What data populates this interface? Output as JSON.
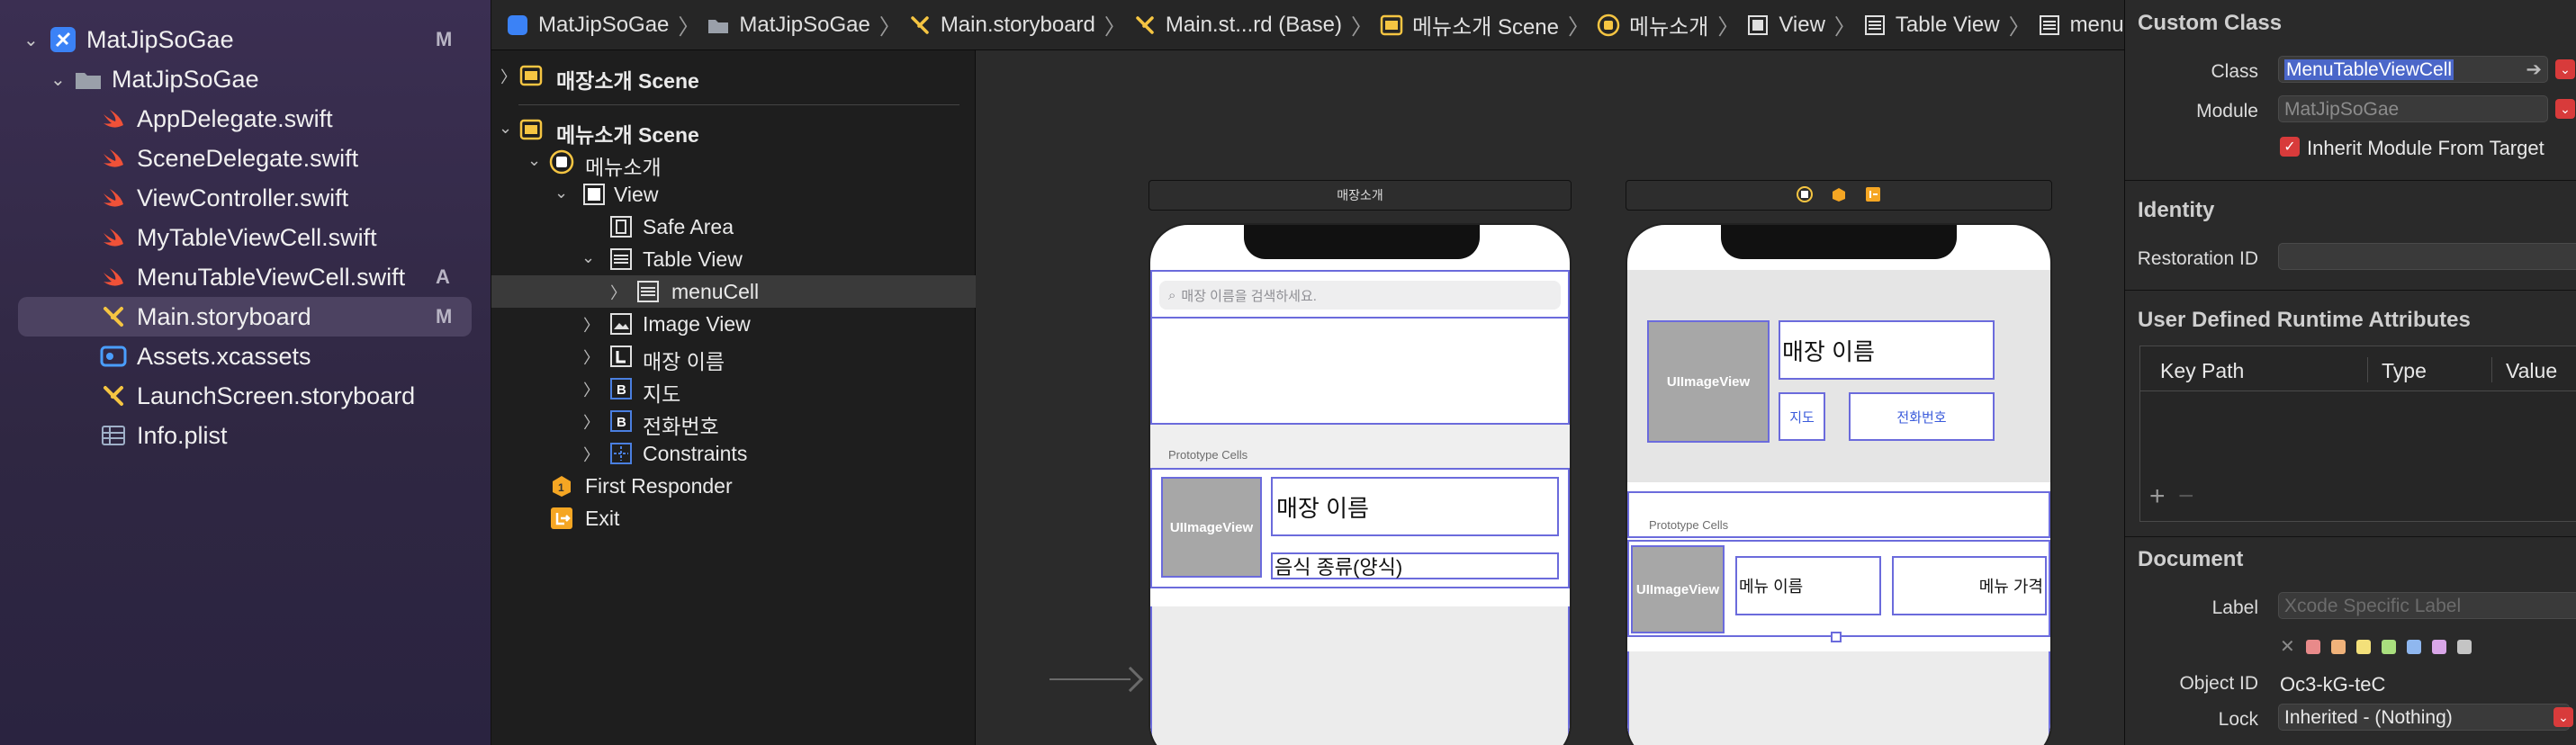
{
  "navigator": {
    "items": [
      {
        "label": "MatJipSoGae",
        "badge": "M"
      },
      {
        "label": "MatJipSoGae",
        "badge": ""
      },
      {
        "label": "AppDelegate.swift",
        "badge": ""
      },
      {
        "label": "SceneDelegate.swift",
        "badge": ""
      },
      {
        "label": "ViewController.swift",
        "badge": ""
      },
      {
        "label": "MyTableViewCell.swift",
        "badge": ""
      },
      {
        "label": "MenuTableViewCell.swift",
        "badge": "A"
      },
      {
        "label": "Main.storyboard",
        "badge": "M"
      },
      {
        "label": "Assets.xcassets",
        "badge": ""
      },
      {
        "label": "LaunchScreen.storyboard",
        "badge": ""
      },
      {
        "label": "Info.plist",
        "badge": ""
      }
    ]
  },
  "jumpbar": {
    "items": [
      "MatJipSoGae",
      "MatJipSoGae",
      "Main.storyboard",
      "Main.st...rd (Base)",
      "메뉴소개 Scene",
      "메뉴소개",
      "View",
      "Table View",
      "menuCell"
    ]
  },
  "outline": {
    "items": [
      {
        "label": "매장소개 Scene"
      },
      {
        "label": "메뉴소개 Scene"
      },
      {
        "label": "메뉴소개"
      },
      {
        "label": "View"
      },
      {
        "label": "Safe Area"
      },
      {
        "label": "Table View"
      },
      {
        "label": "menuCell"
      },
      {
        "label": "Image View"
      },
      {
        "label": "매장 이름"
      },
      {
        "label": "지도"
      },
      {
        "label": "전화번호"
      },
      {
        "label": "Constraints"
      },
      {
        "label": "First Responder"
      },
      {
        "label": "Exit"
      }
    ]
  },
  "canvas": {
    "scene1": {
      "title": "매장소개",
      "search_placeholder": "매장 이름을 검색하세요.",
      "prototype_cells": "Prototype Cells",
      "image_label": "UIImageView",
      "name_label": "매장 이름",
      "food_label": "음식 종류(양식)"
    },
    "scene2": {
      "image_label": "UIImageView",
      "name_label": "매장 이름",
      "map_button": "지도",
      "phone_button": "전화번호",
      "prototype_cells": "Prototype Cells",
      "cell_image_label": "UIImageView",
      "menu_name": "메뉴 이름",
      "menu_price": "메뉴 가격"
    }
  },
  "inspector": {
    "custom_class": {
      "title": "Custom Class",
      "class_label": "Class",
      "class_value": "MenuTableViewCell",
      "module_label": "Module",
      "module_value": "MatJipSoGae",
      "inherit_label": "Inherit Module From Target"
    },
    "identity": {
      "title": "Identity",
      "restoration_label": "Restoration ID"
    },
    "runtime": {
      "title": "User Defined Runtime Attributes",
      "col_keypath": "Key Path",
      "col_type": "Type",
      "col_value": "Value"
    },
    "document": {
      "title": "Document",
      "label_label": "Label",
      "label_placeholder": "Xcode Specific Label",
      "objectid_label": "Object ID",
      "objectid_value": "Oc3-kG-teC",
      "lock_label": "Lock",
      "lock_value": "Inherited - (Nothing)"
    }
  },
  "colors": {
    "accent": "#6b6bdc",
    "selection": "#4c4261",
    "swift": "#f05138"
  }
}
